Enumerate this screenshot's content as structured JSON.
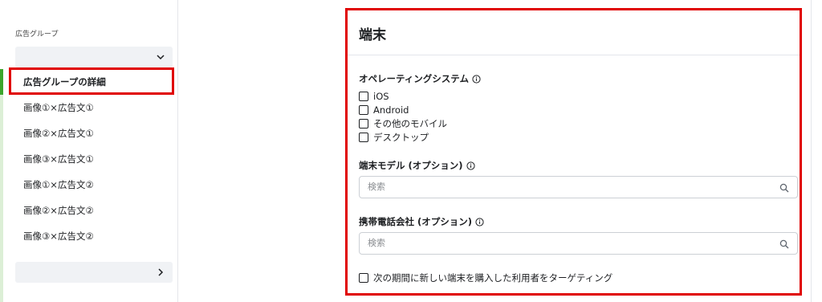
{
  "sidebar": {
    "title": "広告グループ",
    "items": [
      {
        "label": "広告グループの詳細"
      },
      {
        "label": "画像①×広告文①"
      },
      {
        "label": "画像②×広告文①"
      },
      {
        "label": "画像③×広告文①"
      },
      {
        "label": "画像①×広告文②"
      },
      {
        "label": "画像②×広告文②"
      },
      {
        "label": "画像③×広告文②"
      }
    ]
  },
  "panel": {
    "title": "端末",
    "os_label": "オペレーティングシステム",
    "os_options": [
      {
        "label": "iOS",
        "checked": false
      },
      {
        "label": "Android",
        "checked": false
      },
      {
        "label": "その他のモバイル",
        "checked": false
      },
      {
        "label": "デスクトップ",
        "checked": false
      }
    ],
    "model_label": "端末モデル (オプション)",
    "model_placeholder": "検索",
    "carrier_label": "携帯電話会社 (オプション)",
    "carrier_placeholder": "検索",
    "new_device_label": "次の期間に新しい端末を購入した利用者をターゲティング"
  },
  "colors": {
    "highlight": "#e00000",
    "active_accent": "#3ca52c"
  }
}
